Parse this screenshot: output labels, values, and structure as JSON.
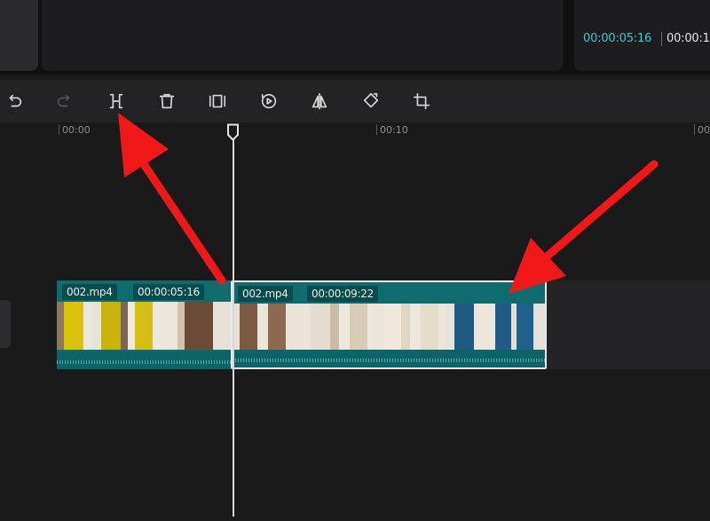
{
  "preview": {
    "current_time": "00:00:05:16",
    "total_time": "00:00:1"
  },
  "toolbar": {
    "tools": [
      {
        "name": "undo",
        "icon": "undo-icon",
        "enabled": true
      },
      {
        "name": "redo",
        "icon": "redo-icon",
        "enabled": false
      },
      {
        "name": "split",
        "icon": "split-icon",
        "enabled": true
      },
      {
        "name": "delete",
        "icon": "trash-icon",
        "enabled": true
      },
      {
        "name": "freeze",
        "icon": "freeze-frame-icon",
        "enabled": true
      },
      {
        "name": "reverse",
        "icon": "reverse-play-icon",
        "enabled": true
      },
      {
        "name": "mirror",
        "icon": "mirror-icon",
        "enabled": true
      },
      {
        "name": "rotate",
        "icon": "rotate-icon",
        "enabled": true
      },
      {
        "name": "crop",
        "icon": "crop-icon",
        "enabled": true
      }
    ]
  },
  "ruler": {
    "labels": [
      "00:00",
      "00:10",
      "00"
    ]
  },
  "timeline": {
    "clips": [
      {
        "filename": "002.mp4",
        "duration": "00:00:05:16",
        "selected": false
      },
      {
        "filename": "002.mp4",
        "duration": "00:00:09:22",
        "selected": true
      }
    ]
  },
  "colors": {
    "accent_teal": "#3fc7cf",
    "clip_fill": "#0f6b6e",
    "annotation_red": "#f01818"
  }
}
